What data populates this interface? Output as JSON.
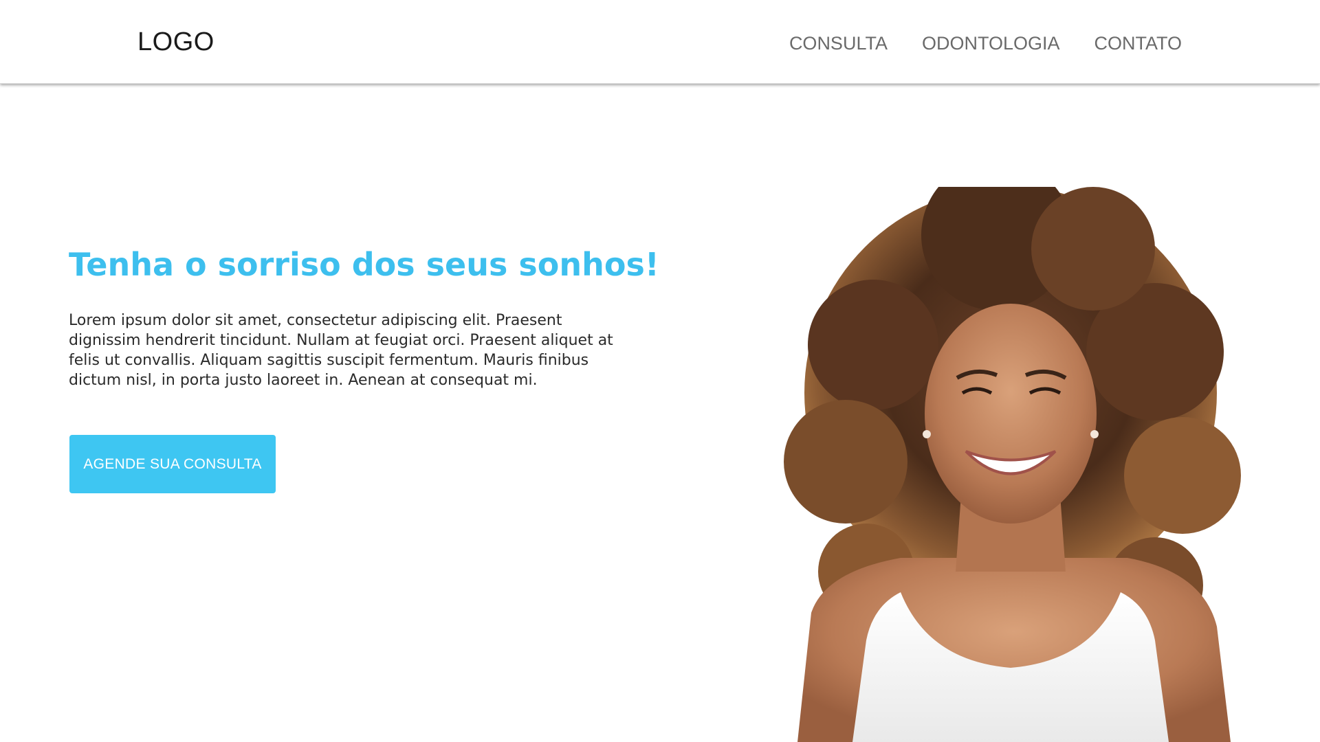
{
  "header": {
    "logo": "LOGO",
    "nav": [
      {
        "label": "CONSULTA"
      },
      {
        "label": "ODONTOLOGIA"
      },
      {
        "label": "CONTATO"
      }
    ]
  },
  "hero": {
    "headline": "Tenha o sorriso dos seus sonhos!",
    "body": "Lorem ipsum dolor sit amet, consectetur adipiscing elit. Praesent dignissim hendrerit tincidunt. Nullam at feugiat orci. Praesent aliquet at felis ut convallis. Aliquam sagittis suscipit fermentum. Mauris finibus dictum nisl, in porta justo laoreet in. Aenean at consequat mi.",
    "cta_label": "AGENDE SUA CONSULTA",
    "image": "smiling-woman-curly-hair-photo"
  },
  "colors": {
    "accent": "#3dbfee",
    "button": "#3ec6f2",
    "nav_text": "#6a6a6a",
    "body_text": "#2a2a2a"
  }
}
